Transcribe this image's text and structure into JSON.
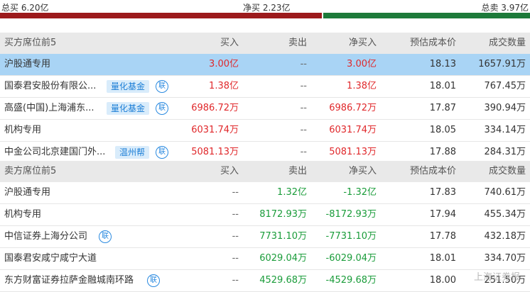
{
  "summary": {
    "total_buy": "总买 6.20亿",
    "net_buy": "净买 2.23亿",
    "total_sell": "总卖 3.97亿",
    "colors": {
      "buy": "#9c1a1c",
      "sell": "#1d7a3a"
    }
  },
  "buy_section": {
    "header": [
      "买方席位前5",
      "买入",
      "卖出",
      "净买入",
      "预估成本价",
      "成交数量"
    ],
    "rows": [
      {
        "name": "沪股通专用",
        "tag": "",
        "lian": false,
        "buy": "3.00亿",
        "sell": "--",
        "net": "3.00亿",
        "cost": "18.13",
        "volume": "1657.91万"
      },
      {
        "name": "国泰君安股份有限公...",
        "tag": "量化基金",
        "lian": true,
        "buy": "1.38亿",
        "sell": "--",
        "net": "1.38亿",
        "cost": "18.01",
        "volume": "767.45万"
      },
      {
        "name": "高盛(中国)上海浦东...",
        "tag": "量化基金",
        "lian": true,
        "buy": "6986.72万",
        "sell": "--",
        "net": "6986.72万",
        "cost": "17.87",
        "volume": "390.94万"
      },
      {
        "name": "机构专用",
        "tag": "",
        "lian": false,
        "buy": "6031.74万",
        "sell": "--",
        "net": "6031.74万",
        "cost": "18.05",
        "volume": "334.14万"
      },
      {
        "name": "中金公司北京建国门外...",
        "tag": "温州帮",
        "lian": true,
        "buy": "5081.13万",
        "sell": "--",
        "net": "5081.13万",
        "cost": "17.88",
        "volume": "284.31万"
      }
    ]
  },
  "sell_section": {
    "header": [
      "卖方席位前5",
      "买入",
      "卖出",
      "净买入",
      "预估成本价",
      "成交数量"
    ],
    "rows": [
      {
        "name": "沪股通专用",
        "lian": false,
        "buy": "--",
        "sell": "1.32亿",
        "net": "-1.32亿",
        "cost": "17.83",
        "volume": "740.61万"
      },
      {
        "name": "机构专用",
        "lian": false,
        "buy": "--",
        "sell": "8172.93万",
        "net": "-8172.93万",
        "cost": "17.94",
        "volume": "455.34万"
      },
      {
        "name": "中信证券上海分公司",
        "lian": true,
        "buy": "--",
        "sell": "7731.10万",
        "net": "-7731.10万",
        "cost": "17.78",
        "volume": "432.18万"
      },
      {
        "name": "国泰君安咸宁咸宁大道",
        "lian": false,
        "buy": "--",
        "sell": "6029.04万",
        "net": "-6029.04万",
        "cost": "18.01",
        "volume": "334.70万"
      },
      {
        "name": "东方财富证券拉萨金融城南环路",
        "lian": true,
        "buy": "--",
        "sell": "4529.68万",
        "net": "-4529.68万",
        "cost": "18.00",
        "volume": "251.50万"
      }
    ]
  },
  "lian_glyph": "联",
  "watermark": "上海证券报"
}
